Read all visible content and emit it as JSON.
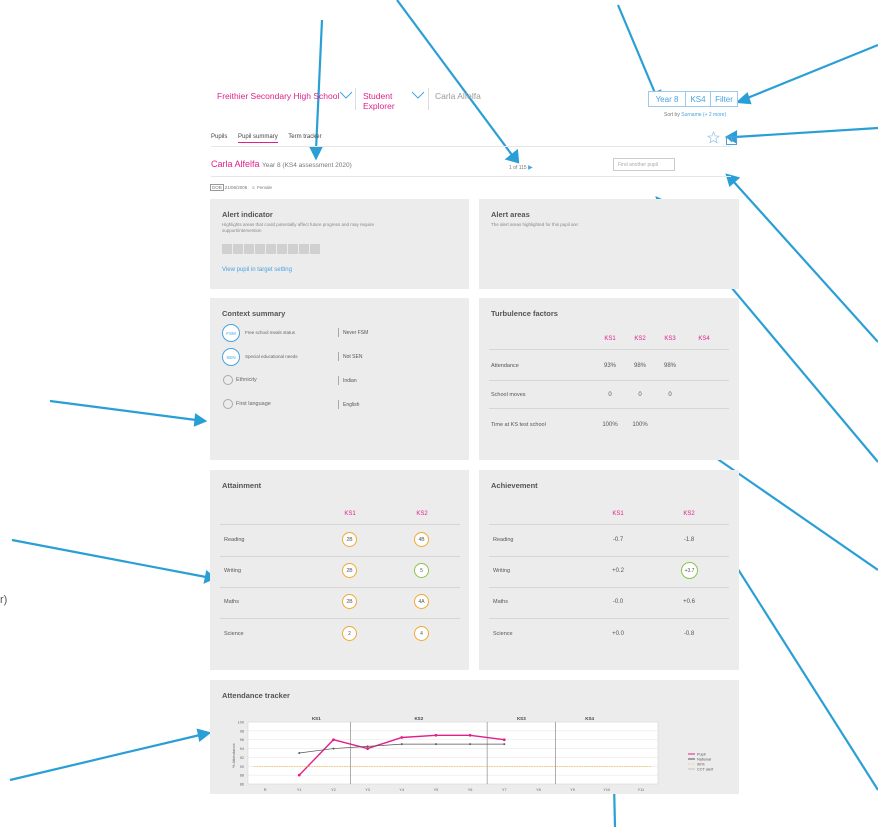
{
  "header": {
    "school": "Freithier Secondary High School",
    "app": "Student Explorer",
    "pupil": "Carla Alfelfa",
    "year_button": "Year 8",
    "ks_button": "KS4",
    "filter_button": "Filter",
    "sort_label": "Sort by",
    "sort_value": "Surname (+ 2 more)"
  },
  "tabs": [
    "Pupils",
    "Pupil summary",
    "Term tracker"
  ],
  "pupil_line": {
    "name": "Carla Alfelfa",
    "detail": "Year 8 (KS4 assessment 2020)",
    "pager": "1 of 115",
    "find_placeholder": "Find another pupil"
  },
  "meta": {
    "badge": "DOB",
    "dob": "21/06/2006",
    "gender": "Female"
  },
  "alert_indicator": {
    "title": "Alert indicator",
    "desc": "Highlights areas that could potentially affect future progress and may require support/intervention",
    "link": "View pupil in target setting"
  },
  "alert_areas": {
    "title": "Alert areas",
    "desc": "The alert areas highlighted for this pupil are:"
  },
  "context": {
    "title": "Context summary",
    "rows": [
      {
        "icon": "FSM",
        "label": "Free school meals status",
        "value": "Never FSM"
      },
      {
        "icon": "SEN",
        "label": "Special educational needs",
        "value": "Not SEN"
      },
      {
        "icon": "",
        "label": "Ethnicity",
        "value": "Indian"
      },
      {
        "icon": "",
        "label": "First language",
        "value": "English"
      }
    ]
  },
  "turbulence": {
    "title": "Turbulence factors",
    "cols": [
      "KS1",
      "KS2",
      "KS3",
      "KS4"
    ],
    "rows": [
      {
        "label": "Attendance",
        "values": [
          "93%",
          "98%",
          "98%",
          ""
        ]
      },
      {
        "label": "School moves",
        "values": [
          "0",
          "0",
          "0",
          ""
        ]
      },
      {
        "label": "Time at KS test school",
        "values": [
          "100%",
          "100%",
          "",
          ""
        ]
      }
    ]
  },
  "attainment": {
    "title": "Attainment",
    "cols": [
      "KS1",
      "KS2"
    ],
    "rows": [
      {
        "label": "Reading",
        "values": [
          "2B",
          "4B"
        ]
      },
      {
        "label": "Writing",
        "values": [
          "2B",
          "5"
        ]
      },
      {
        "label": "Maths",
        "values": [
          "2B",
          "4A"
        ]
      },
      {
        "label": "Science",
        "values": [
          "2",
          "4"
        ]
      }
    ]
  },
  "achievement": {
    "title": "Achievement",
    "cols": [
      "KS1",
      "KS2"
    ],
    "rows": [
      {
        "label": "Reading",
        "values": [
          "-0.7",
          "-1.8"
        ]
      },
      {
        "label": "Writing",
        "values": [
          "+0.2",
          "+3.7"
        ]
      },
      {
        "label": "Maths",
        "values": [
          "-0.0",
          "+0.6"
        ]
      },
      {
        "label": "Science",
        "values": [
          "+0.0",
          "-0.8"
        ]
      }
    ]
  },
  "attendance": {
    "title": "Attendance tracker",
    "ylabel": "% Attendance",
    "stages": [
      "KS1",
      "KS2",
      "KS3",
      "KS4"
    ],
    "legend": [
      "Pupil",
      "National",
      "90%",
      "CCT alert"
    ],
    "colors": {
      "pupil": "#e0218a",
      "national": "#555555",
      "threshold": "#f0a830",
      "accent": "#4aa3df"
    }
  },
  "chart_data": {
    "type": "line",
    "x": [
      "R",
      "Y1",
      "Y2",
      "Y3",
      "Y4",
      "Y5",
      "Y6",
      "Y7",
      "Y8",
      "Y9",
      "Y10",
      "Y11"
    ],
    "series": [
      {
        "name": "Pupil",
        "values": [
          null,
          88,
          96,
          94,
          96.5,
          97,
          97,
          96,
          null,
          null,
          null,
          null
        ]
      },
      {
        "name": "National",
        "values": [
          null,
          93,
          94,
          94.5,
          95,
          95,
          95,
          95,
          null,
          null,
          null,
          null
        ]
      },
      {
        "name": "90%",
        "values": [
          90,
          90,
          90,
          90,
          90,
          90,
          90,
          90,
          90,
          90,
          90,
          90
        ]
      }
    ],
    "yticks": [
      "100",
      "98",
      "96",
      "94",
      "92",
      "90",
      "88",
      "86"
    ],
    "ylim": [
      86,
      100
    ],
    "ylabel": "% Attendance",
    "legend": "right"
  }
}
